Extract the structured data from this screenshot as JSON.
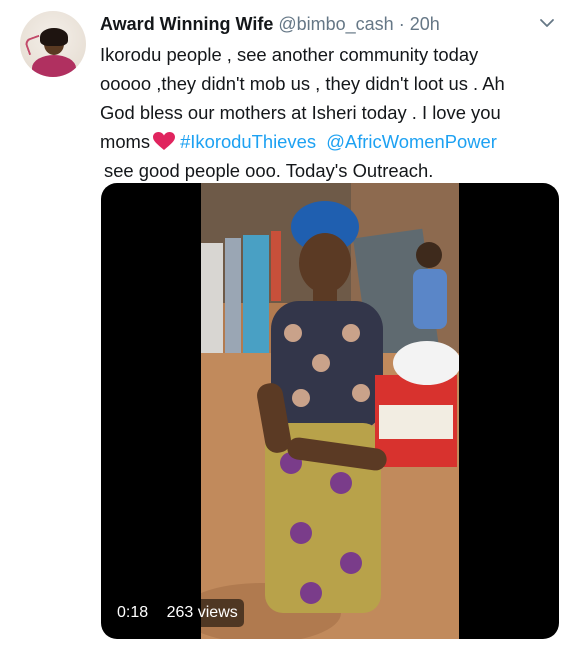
{
  "tweet": {
    "display_name": "Award Winning Wife",
    "handle": "@bimbo_cash",
    "separator": "·",
    "timestamp": "20h",
    "avatar_icon": "profile-avatar",
    "menu_icon": "chevron-down-icon",
    "text": {
      "line1": "Ikorodu people , see another community today",
      "line2": "ooooo ,they didn't mob us , they didn't loot us . Ah",
      "line3": "God bless our mothers at Isheri today . I love you",
      "line4_word": "moms",
      "heart_icon": "red-heart-emoji",
      "hashtag": "#IkoroduThieves",
      "mention": "@AfricWomenPower",
      "line5": "see good people ooo. Today's Outreach."
    },
    "media": {
      "duration": "0:18",
      "views_count": "263",
      "views_label": "views"
    }
  },
  "colors": {
    "text_primary": "#14171a",
    "text_secondary": "#657786",
    "link_blue": "#1da1f2",
    "heart_red": "#e0245e",
    "background": "#ffffff"
  }
}
